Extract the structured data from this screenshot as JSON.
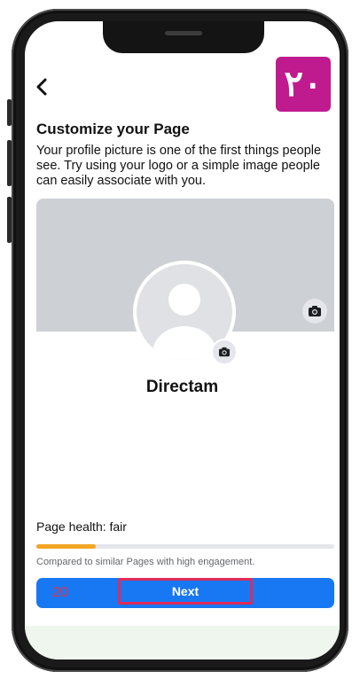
{
  "header": {
    "back_icon": "chevron-left-icon",
    "badge_text": "۲۰"
  },
  "content": {
    "title": "Customize your Page",
    "description": "Your profile picture is one of the first things people see. Try using your logo or a simple image people can easily associate with you.",
    "page_name": "Directam"
  },
  "health": {
    "label": "Page health:  fair",
    "progress": 0.2,
    "compare_text": "Compared to similar Pages with high engagement."
  },
  "footer": {
    "number": "20",
    "next_label": "Next"
  },
  "colors": {
    "primary": "#1877f2",
    "badge": "#bf1b8e",
    "progress": "#f2a623",
    "highlight_border": "#e02a5a"
  }
}
